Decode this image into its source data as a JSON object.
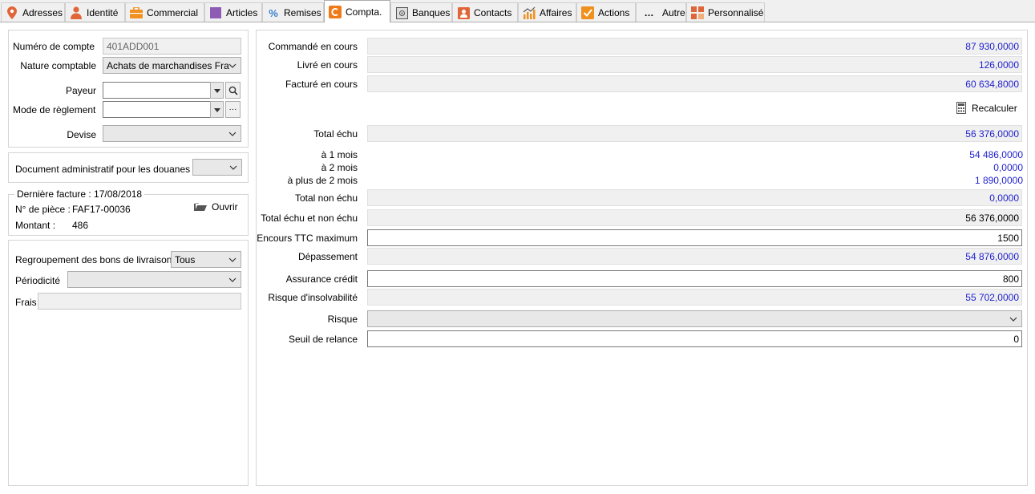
{
  "tabs": [
    {
      "label": "Adresses",
      "icon": "map-pin-icon",
      "color": "#e0663a"
    },
    {
      "label": "Identité",
      "icon": "person-icon",
      "color": "#e0663a"
    },
    {
      "label": "Commercial",
      "icon": "briefcase-icon",
      "color": "#f0901e"
    },
    {
      "label": "Articles",
      "icon": "square-icon",
      "color": "#8e5bb5"
    },
    {
      "label": "Remises",
      "icon": "percent-icon",
      "color": "#3b7fd0"
    },
    {
      "label": "Compta.",
      "icon": "compta-icon",
      "color": "#f07a18"
    },
    {
      "label": "Banques",
      "icon": "safe-icon",
      "color": "#666666"
    },
    {
      "label": "Contacts",
      "icon": "contact-card-icon",
      "color": "#e0663a"
    },
    {
      "label": "Affaires",
      "icon": "chart-icon",
      "color": "#f0901e"
    },
    {
      "label": "Actions",
      "icon": "checkbox-icon",
      "color": "#f0901e"
    },
    {
      "label": "Autre",
      "icon": "dots-icon",
      "color": "#333333"
    },
    {
      "label": "Personnalisé",
      "icon": "grid-icon",
      "color": "#e0663a"
    }
  ],
  "active_tab": "Compta.",
  "left": {
    "numero_compte_label": "Numéro de compte",
    "numero_compte_value": "401ADD001",
    "nature_comptable_label": "Nature comptable",
    "nature_comptable_value": "Achats de marchandises Fra",
    "payeur_label": "Payeur",
    "payeur_value": "",
    "mode_reglement_label": "Mode de règlement",
    "mode_reglement_value": "",
    "devise_label": "Devise",
    "devise_value": "",
    "douanes_label": "Document administratif pour les douanes",
    "douanes_value": "",
    "derniere_facture_label": "Dernière facture : 17/08/2018",
    "piece_label": "N° de pièce :",
    "piece_value": "FAF17-00036",
    "montant_label": "Montant :",
    "montant_value": "486",
    "ouvrir_label": "Ouvrir",
    "regroupement_label": "Regroupement des bons de livraison",
    "regroupement_value": "Tous",
    "periodicite_label": "Périodicité",
    "periodicite_value": "",
    "frais_label": "Frais",
    "frais_value": ""
  },
  "right": {
    "commande_label": "Commandé en cours",
    "commande_value": "87 930,0000",
    "livre_label": "Livré en cours",
    "livre_value": "126,0000",
    "facture_label": "Facturé en cours",
    "facture_value": "60 634,8000",
    "recalculer_label": "Recalculer",
    "total_echu_label": "Total échu",
    "total_echu_value": "56 376,0000",
    "m1_label": "à 1 mois",
    "m1_value": "54 486,0000",
    "m2_label": "à 2 mois",
    "m2_value": "0,0000",
    "m3_label": "à plus de 2 mois",
    "m3_value": "1 890,0000",
    "non_echu_label": "Total non échu",
    "non_echu_value": "0,0000",
    "echu_non_echu_label": "Total échu et non échu",
    "echu_non_echu_value": "56 376,0000",
    "encours_label": "Encours TTC maximum",
    "encours_value": "1500",
    "depassement_label": "Dépassement",
    "depassement_value": "54 876,0000",
    "assurance_label": "Assurance crédit",
    "assurance_value": "800",
    "risque_insolv_label": "Risque d'insolvabilité",
    "risque_insolv_value": "55 702,0000",
    "risque_label": "Risque",
    "risque_value": "",
    "seuil_label": "Seuil de relance",
    "seuil_value": "0"
  },
  "colors": {
    "blue_value": "#1f1fd0",
    "accent": "#f07a18"
  }
}
